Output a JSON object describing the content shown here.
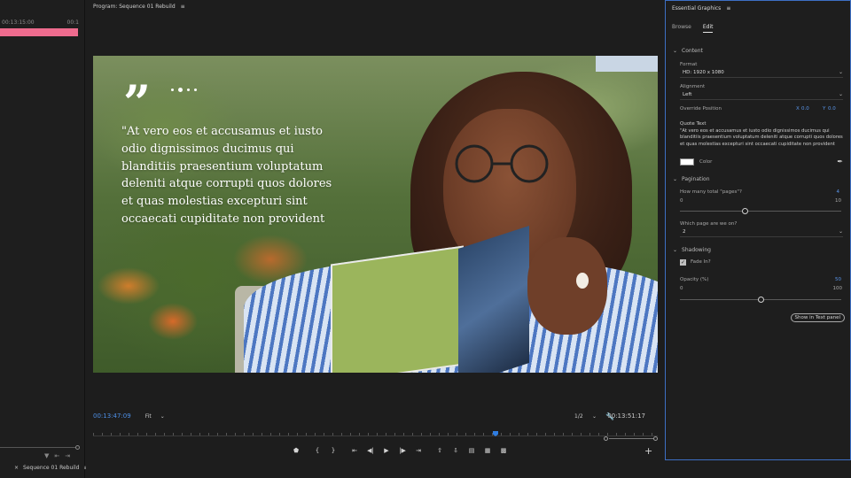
{
  "left_panel": {
    "timecode_left": "00:13:15:00",
    "timecode_right": "00:1",
    "sequence_tab": "Sequence 01 Rebuild",
    "accent_color": "#ee6b8e"
  },
  "program": {
    "panel_title": "Program: Sequence 01 Rebuild",
    "current_timecode": "00:13:47:09",
    "fit_label": "Fit",
    "resolution": "1/2",
    "duration_timecode": "00:13:51:17",
    "overlay": {
      "quote_mark": "”",
      "quote_text": "\"At vero eos et accusamus et iusto\nodio dignissimos ducimus qui\nblanditiis praesentium voluptatum\ndeleniti atque corrupti quos dolores\net quas molestias excepturi sint\noccaecati cupiditate non provident"
    }
  },
  "essential_graphics": {
    "title": "Essential Graphics",
    "tabs": [
      "Browse",
      "Edit"
    ],
    "active_tab": "Edit",
    "content": {
      "section_label": "Content",
      "format_label": "Format",
      "format_value": "HD: 1920 x 1080",
      "alignment_label": "Alignment",
      "alignment_value": "Left",
      "override_label": "Override Position",
      "x_label": "X",
      "x_value": "0.0",
      "y_label": "Y",
      "y_value": "0.0",
      "quote_text_label": "Quote Text",
      "quote_text_value": "\"At vero eos et accusamus et iusto odio dignissimos ducimus qui blanditiis praesentium voluptatum deleniti atque corrupti quos dolores et quas molestias excepturi sint occaecati cupiditate non provident",
      "color_label": "Color",
      "color_value": "#ffffff"
    },
    "pagination": {
      "section_label": "Pagination",
      "total_pages_label": "How many total \"pages\"?",
      "total_pages_value": "4",
      "slider_min": "0",
      "slider_max": "10",
      "slider_value": 4,
      "which_page_label": "Which page are we on?",
      "which_page_value": "2"
    },
    "shadowing": {
      "section_label": "Shadowing",
      "fade_label": "Fade In?",
      "fade_checked": true,
      "opacity_label": "Opacity (%)",
      "opacity_value": "50",
      "slider_min": "0",
      "slider_max": "100",
      "slider_value": 50
    },
    "show_in_text_panel": "Show in Text panel"
  }
}
